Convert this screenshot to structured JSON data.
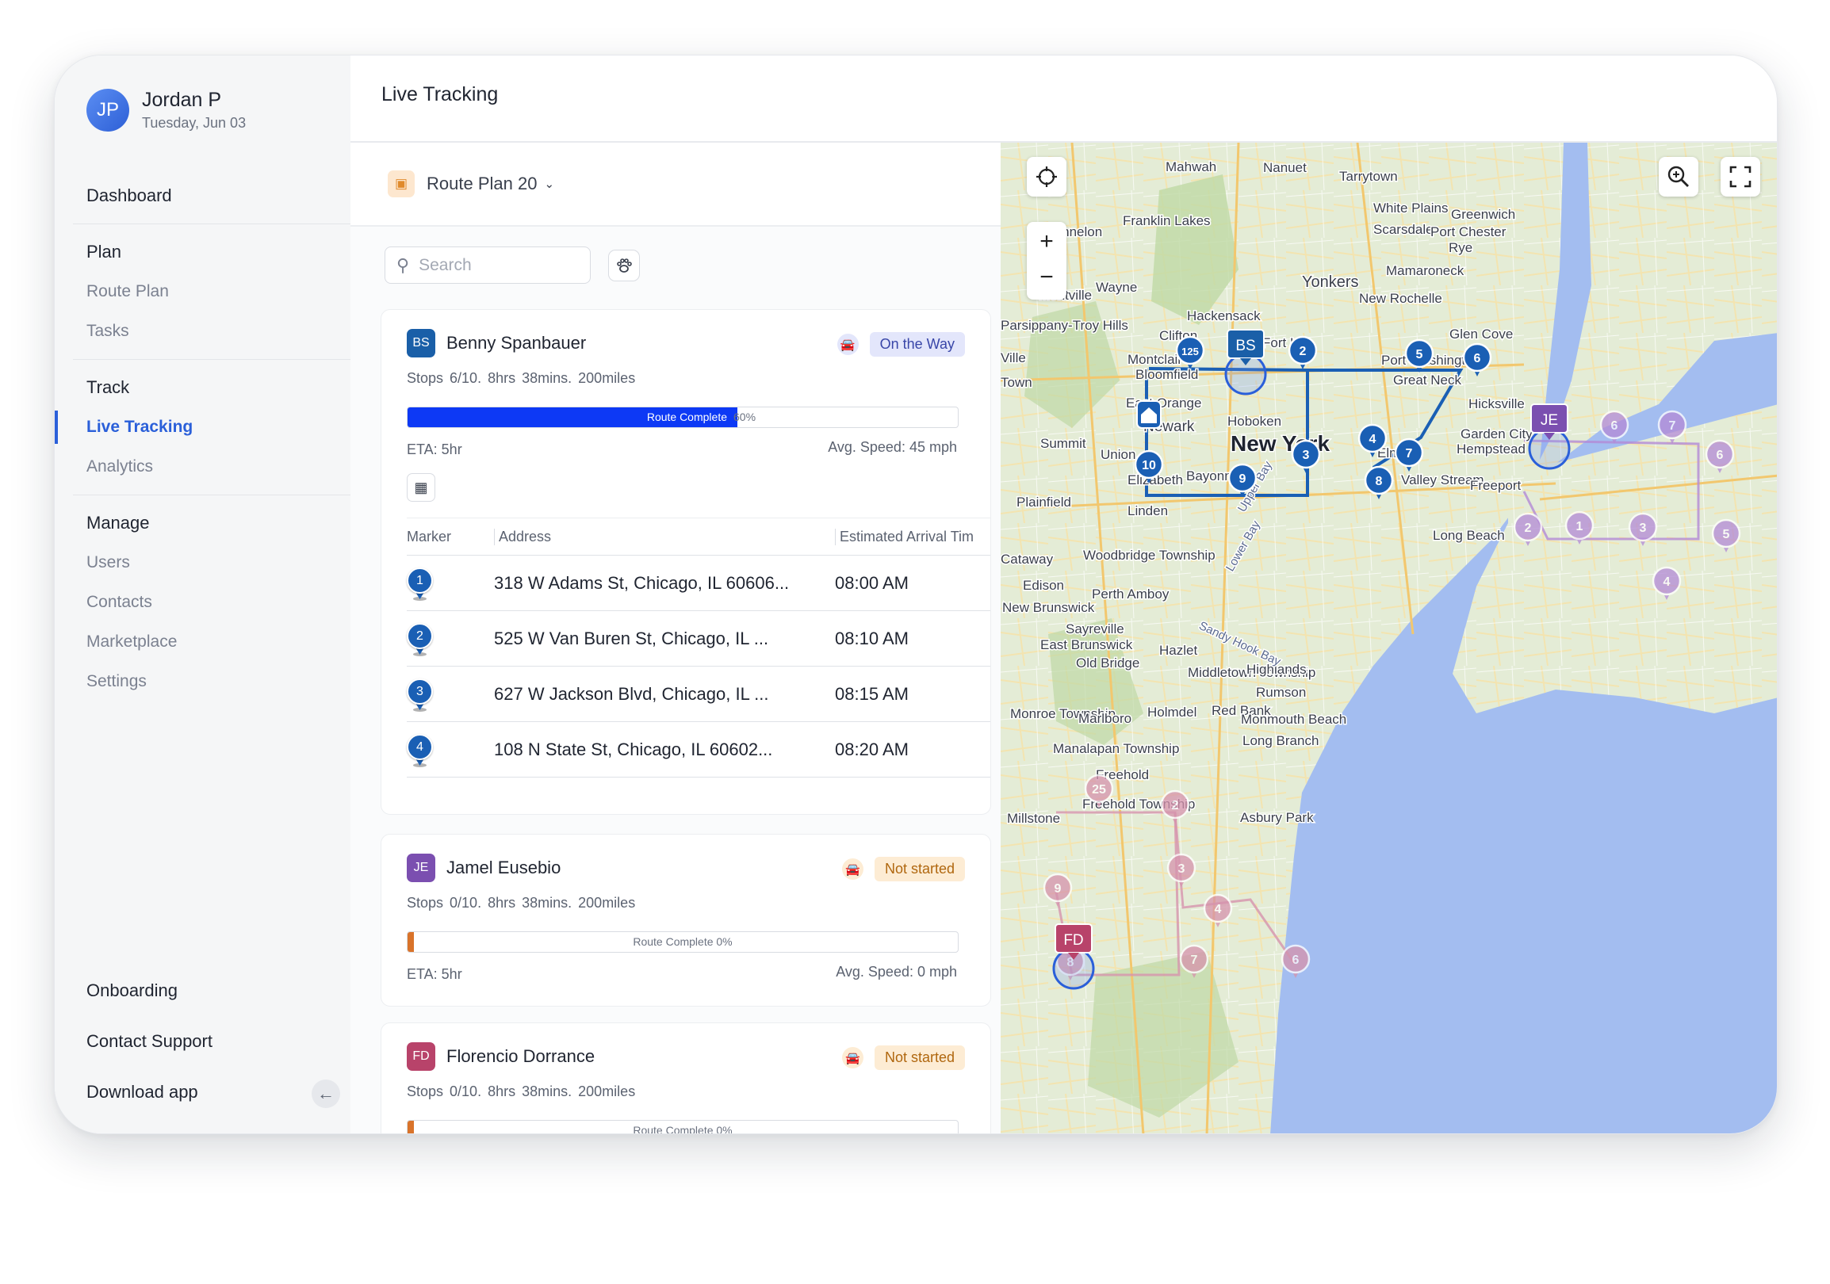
{
  "user": {
    "initials": "JP",
    "name": "Jordan P",
    "date": "Tuesday, Jun 03"
  },
  "nav": {
    "dashboard": "Dashboard",
    "plan": {
      "title": "Plan",
      "items": [
        "Route Plan",
        "Tasks"
      ]
    },
    "track": {
      "title": "Track",
      "items": [
        "Live Tracking",
        "Analytics"
      ],
      "active": "Live Tracking"
    },
    "manage": {
      "title": "Manage",
      "items": [
        "Users",
        "Contacts",
        "Marketplace",
        "Settings"
      ]
    },
    "bottom": [
      "Onboarding",
      "Contact Support",
      "Download app"
    ]
  },
  "header": {
    "title": "Live Tracking"
  },
  "route_plan": {
    "label": "Route Plan 20"
  },
  "search": {
    "placeholder": "Search"
  },
  "drivers": [
    {
      "initials": "BS",
      "name": "Benny Spanbauer",
      "color": "#1a5fa8",
      "status": "On the Way",
      "status_bg": "#e3e6fb",
      "status_color": "#3946a8",
      "car_color": "#3946a8",
      "car_bg": "#e3e6fb",
      "stops": "Stops  6/10.",
      "time": "8hrs 38mins.",
      "miles": "200miles",
      "progress_label": "Route Complete",
      "progress_pct_text": "60%",
      "progress": 0.6,
      "bar_color": "#0d39f5",
      "eta": "ETA: 5hr",
      "avg_speed": "Avg. Speed: 45 mph"
    },
    {
      "initials": "JE",
      "name": "Jamel Eusebio",
      "color": "#7b4fb0",
      "status": "Not started",
      "status_bg": "#fdecd4",
      "status_color": "#b0670f",
      "car_color": "#d9832a",
      "car_bg": "#fdecd4",
      "stops": "Stops  0/10.",
      "time": "8hrs 38mins.",
      "miles": "200miles",
      "progress_label": "Route Complete 0%",
      "progress": 0,
      "bar_color": "#d9732a",
      "eta": "ETA: 5hr",
      "avg_speed": "Avg. Speed: 0 mph"
    },
    {
      "initials": "FD",
      "name": "Florencio Dorrance",
      "color": "#b8436a",
      "status": "Not started",
      "status_bg": "#fdecd4",
      "status_color": "#b0670f",
      "car_color": "#d9832a",
      "car_bg": "#fdecd4",
      "stops": "Stops  0/10.",
      "time": "8hrs 38mins.",
      "miles": "200miles",
      "progress_label": "Route Complete 0%",
      "progress": 0,
      "bar_color": "#d9732a"
    }
  ],
  "stops_table": {
    "headers": [
      "Marker",
      "Address",
      "Estimated Arrival Tim"
    ],
    "rows": [
      {
        "marker": "1",
        "address": "318 W Adams St, Chicago, IL 60606...",
        "time": "08:00 AM"
      },
      {
        "marker": "2",
        "address": "525 W Van Buren St, Chicago, IL ...",
        "time": "08:10 AM"
      },
      {
        "marker": "3",
        "address": "627 W Jackson Blvd, Chicago, IL ...",
        "time": "08:15 AM"
      },
      {
        "marker": "4",
        "address": "108 N State St, Chicago, IL 60602...",
        "time": "08:20 AM"
      }
    ]
  },
  "map": {
    "places": [
      "Mahwah",
      "Nanuet",
      "Tarrytown",
      "Franklin Lakes",
      "White Plains",
      "Greenwich",
      "Scarsdale",
      "Port Chester",
      "Rye",
      "Kinnelon",
      "Mamaroneck",
      "Montville",
      "Wayne",
      "Yonkers",
      "New Rochelle",
      "Hackensack",
      "Parsippany-Troy Hills",
      "Clifton",
      "Fort Lee",
      "Glen Cove",
      "Montclair",
      "Bloomfield",
      "Port Washington",
      "Great Neck",
      "East Orange",
      "Newark",
      "Hoboken",
      "New York",
      "Hicksville",
      "Garden City",
      "Summit",
      "Union",
      "Elmont",
      "Hempstead",
      "Elizabeth",
      "Bayonne",
      "Valley Stream",
      "Freeport",
      "Plainfield",
      "Linden",
      "Long Beach",
      "Woodbridge Township",
      "Edison",
      "Perth Amboy",
      "New Brunswick",
      "Sayreville",
      "East Brunswick",
      "Old Bridge",
      "Hazlet",
      "Middletown Township",
      "Highlands",
      "Rumson",
      "Monroe Township",
      "Marlboro",
      "Holmdel",
      "Red Bank",
      "Monmouth Beach",
      "Long Branch",
      "Manalapan Township",
      "Freehold",
      "Freehold Township",
      "Asbury Park",
      "Millstone",
      "Ville",
      "Town",
      "Cataway",
      "Upper Bay",
      "Lower Bay",
      "Sandy Hook Bay"
    ],
    "driver_markers": [
      "BS",
      "JE",
      "FD"
    ],
    "blue_stops": [
      "125",
      "2",
      "5",
      "6",
      "10",
      "3",
      "4",
      "7",
      "9",
      "8"
    ],
    "purple_stops": [
      "6",
      "7",
      "6",
      "2",
      "1",
      "3",
      "5",
      "4"
    ],
    "pink_stops": [
      "25",
      "2",
      "3",
      "4",
      "9",
      "8",
      "7",
      "6"
    ]
  }
}
